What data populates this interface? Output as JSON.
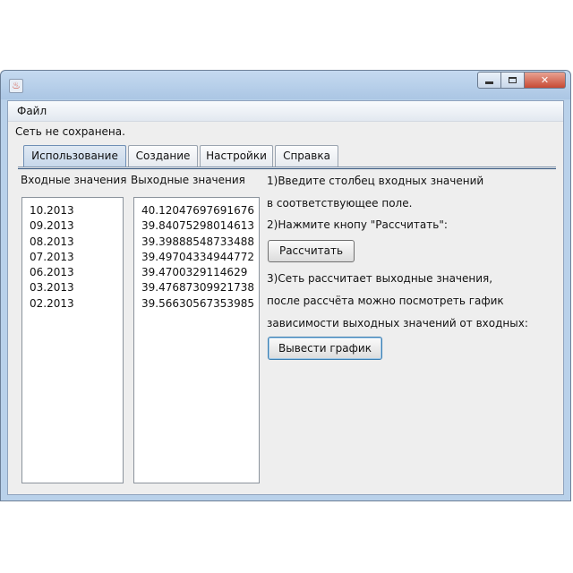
{
  "window": {
    "title": ""
  },
  "menu": {
    "items": [
      "Файл"
    ]
  },
  "status": "Сеть не сохранена.",
  "tabs": [
    "Использование",
    "Создание",
    "Настройки",
    "Справка"
  ],
  "usage": {
    "input_label": "Входные значения",
    "output_label": "Выходные значения",
    "inputs": [
      "10.2013",
      "09.2013",
      "08.2013",
      "07.2013",
      "06.2013",
      "03.2013",
      "02.2013"
    ],
    "outputs": [
      "40.12047697691676",
      "39.84075298014613",
      "39.39888548733488",
      "39.49704334944772",
      "39.4700329114629",
      "39.47687309921738",
      "39.56630567353985"
    ],
    "instructions": {
      "step1_line1": "1)Введите столбец входных значений",
      "step1_line2": "в соответствующее поле.",
      "step2": "2)Нажмите кнопу \"Рассчитать\":",
      "calculate_button": "Рассчитать",
      "step3_line1": "3)Сеть рассчитает выходные значения,",
      "step3_line2": "после рассчёта можно посмотреть гафик",
      "step3_line3": "зависимости выходных значений от входных:",
      "plot_button": "Вывести график"
    }
  }
}
